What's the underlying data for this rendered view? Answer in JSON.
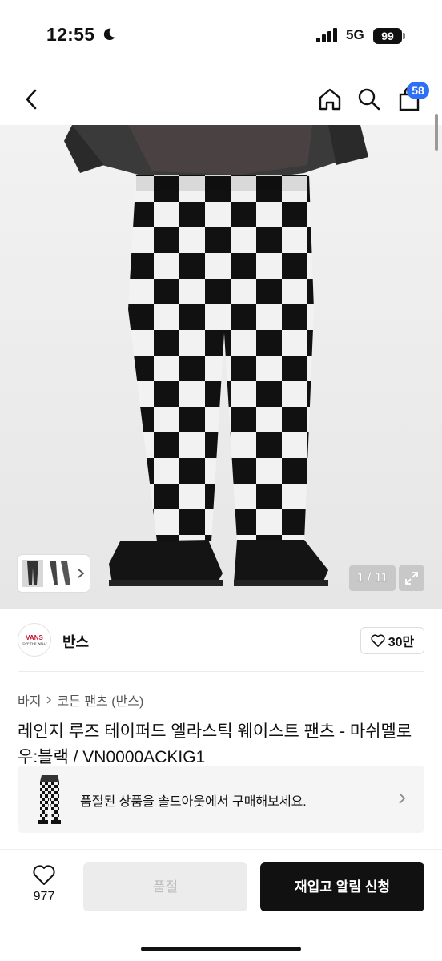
{
  "status_bar": {
    "time": "12:55",
    "network": "5G",
    "battery": "99"
  },
  "nav": {
    "cart_count": "58",
    "icons": [
      "back-icon",
      "home-icon",
      "search-icon",
      "shopping-bag-icon"
    ]
  },
  "gallery": {
    "counter": "1 / 11"
  },
  "brand": {
    "name": "반스",
    "logo_text": "VANS",
    "logo_subtext": "\"OFF THE WALL\"",
    "likes": "30만"
  },
  "breadcrumb": {
    "category": "바지",
    "subcategory": "코튼 팬츠 (반스)"
  },
  "product": {
    "title": "레인지 루즈 테이퍼드 엘라스틱 웨이스트 팬츠 - 마쉬멜로우:블랙 / VN0000ACKIG1"
  },
  "soldout_banner": {
    "text": "품절된 상품을 솔드아웃에서 구매해보세요."
  },
  "bottom_bar": {
    "wish_count": "977",
    "soldout_label": "품절",
    "restock_label": "재입고 알림 신청"
  },
  "colors": {
    "badge": "#2f6ff5",
    "primary_button": "#111111",
    "disabled_button": "#ececec"
  }
}
